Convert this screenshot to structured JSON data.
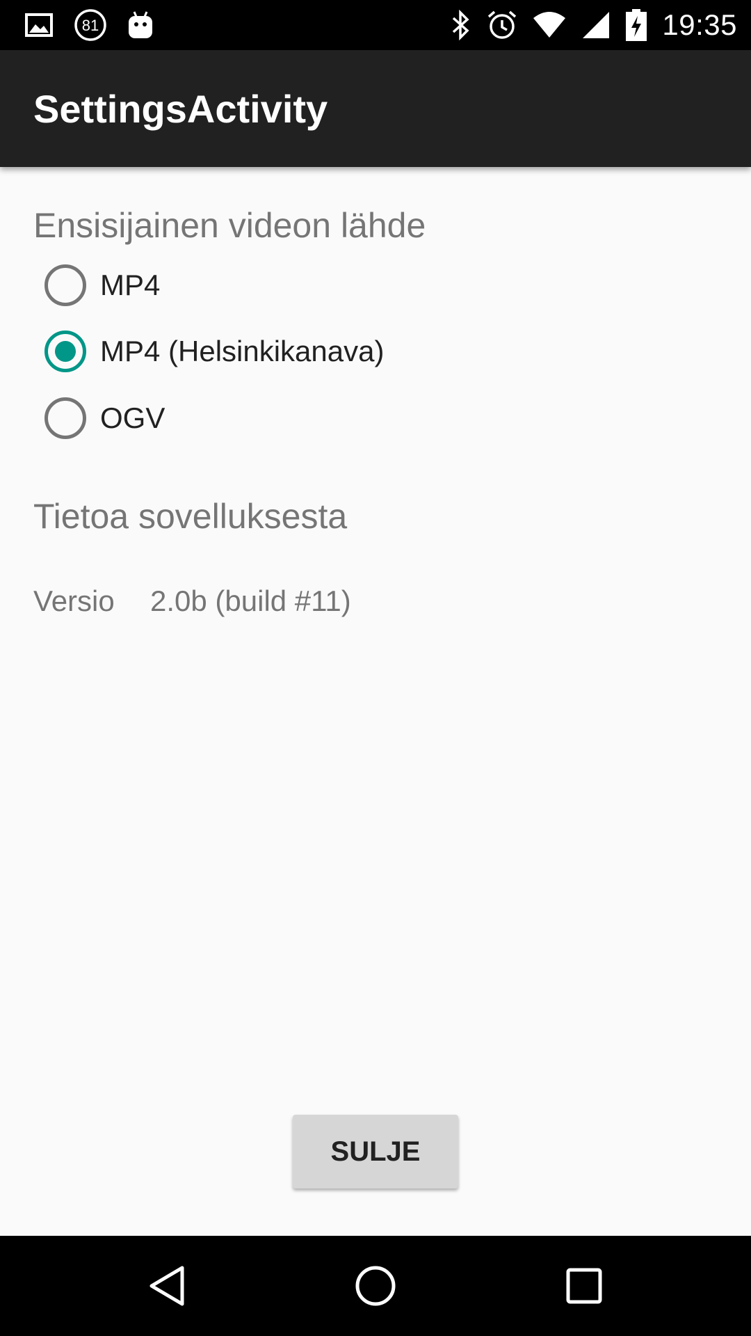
{
  "status_bar": {
    "time": "19:35",
    "notification_badge": "81",
    "left_icons": [
      "image-icon",
      "badge-81-icon",
      "android-icon"
    ],
    "right_icons": [
      "bluetooth-icon",
      "alarm-icon",
      "wifi-icon",
      "signal-icon",
      "battery-charging-icon"
    ]
  },
  "app_bar": {
    "title": "SettingsActivity"
  },
  "video_source": {
    "heading": "Ensisijainen videon lähde",
    "options": [
      {
        "label": "MP4",
        "selected": false
      },
      {
        "label": "MP4 (Helsinkikanava)",
        "selected": true
      },
      {
        "label": "OGV",
        "selected": false
      }
    ]
  },
  "about": {
    "heading": "Tietoa sovelluksesta",
    "version_label": "Versio",
    "version_value": "2.0b (build #11)"
  },
  "close_button": {
    "label": "SULJE"
  },
  "nav_bar": {
    "icons": [
      "back-icon",
      "home-icon",
      "recents-icon"
    ]
  },
  "colors": {
    "accent": "#009688",
    "app_bar": "#212121",
    "background": "#fafafa",
    "heading_text": "#757575"
  }
}
